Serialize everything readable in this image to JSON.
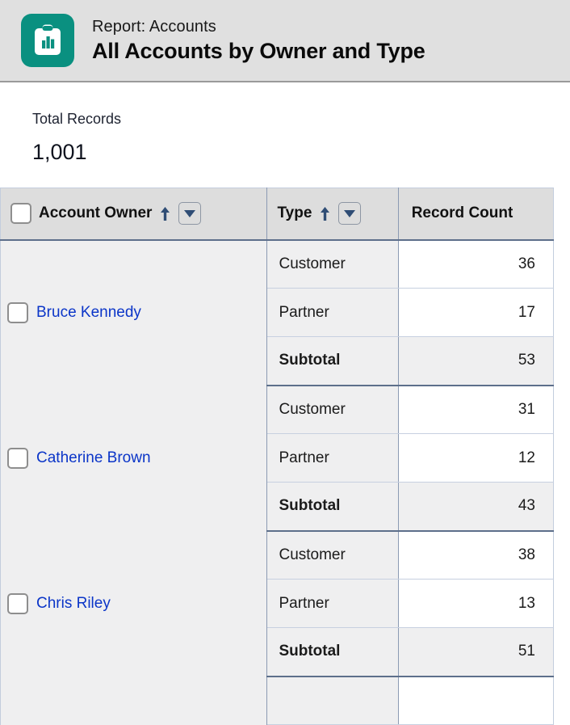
{
  "header": {
    "icon": "report-clipboard-chart-icon",
    "eyebrow": "Report: Accounts",
    "title": "All Accounts by Owner and Type",
    "accent_color": "#0a9080",
    "band_color": "#e0e0e0"
  },
  "summary": {
    "label": "Total Records",
    "value": "1,001"
  },
  "table": {
    "columns": [
      {
        "key": "owner",
        "label": "Account Owner",
        "sort": "asc",
        "sort_icon": "arrow-up-icon",
        "menu_icon": "chevron-down-icon",
        "has_checkbox": true
      },
      {
        "key": "type",
        "label": "Type",
        "sort": "asc",
        "sort_icon": "arrow-up-icon",
        "menu_icon": "chevron-down-icon",
        "has_checkbox": false
      },
      {
        "key": "count",
        "label": "Record Count",
        "sort": null,
        "has_checkbox": false
      }
    ],
    "link_color": "#0b35c8",
    "subtotal_label": "Subtotal",
    "groups": [
      {
        "owner": "Bruce Kennedy",
        "rows": [
          {
            "type": "Customer",
            "count": "36"
          },
          {
            "type": "Partner",
            "count": "17"
          }
        ],
        "subtotal": "53"
      },
      {
        "owner": "Catherine Brown",
        "rows": [
          {
            "type": "Customer",
            "count": "31"
          },
          {
            "type": "Partner",
            "count": "12"
          }
        ],
        "subtotal": "43"
      },
      {
        "owner": "Chris Riley",
        "rows": [
          {
            "type": "Customer",
            "count": "38"
          },
          {
            "type": "Partner",
            "count": "13"
          }
        ],
        "subtotal": "51"
      }
    ]
  }
}
